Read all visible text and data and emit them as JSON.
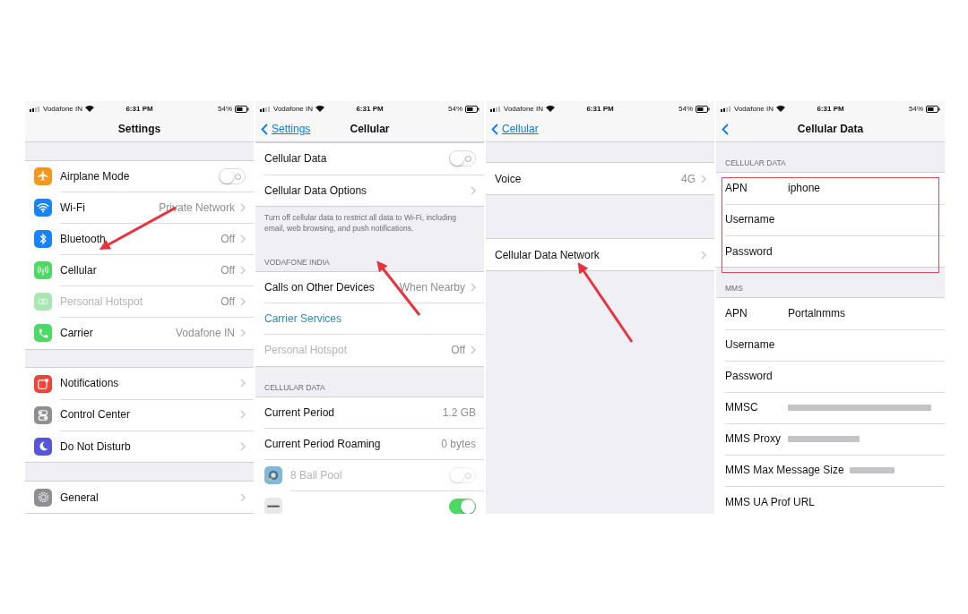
{
  "panels": [
    {
      "status_bar": {
        "carrier": "Vodafone IN",
        "time": "6:31 PM",
        "battery": "54%"
      },
      "nav": {
        "title": "Settings"
      },
      "sections": [
        {
          "highlighted": false,
          "rows": [
            {
              "kind": "toggle",
              "color": "#f6961e",
              "label": "Airplane Mode",
              "on": false,
              "disabled": false
            },
            {
              "kind": "nav",
              "color": "#1a82fb",
              "label": "Wi-Fi",
              "value": "Private Network",
              "disabled": false
            },
            {
              "kind": "nav",
              "color": "#1a82fb",
              "label": "Bluetooth",
              "value": "Off",
              "disabled": false
            },
            {
              "kind": "nav",
              "color": "#4cd964",
              "label": "Cellular",
              "value": "Off",
              "disabled": false
            },
            {
              "kind": "nav",
              "color": "#a8e6b4",
              "label": "Personal Hotspot",
              "value": "Off",
              "disabled": true
            },
            {
              "kind": "nav",
              "color": "#4cd964",
              "label": "Carrier",
              "value": "Vodafone IN",
              "disabled": false
            }
          ]
        },
        {
          "highlighted": false,
          "rows": [
            {
              "kind": "nav",
              "color": "#f0453a",
              "label": "Notifications",
              "disabled": false
            },
            {
              "kind": "nav",
              "color": "#8e8e93",
              "label": "Control Center",
              "disabled": false
            },
            {
              "kind": "nav",
              "color": "#5856d6",
              "label": "Do Not Disturb",
              "disabled": false
            }
          ]
        },
        {
          "highlighted": false,
          "rows": [
            {
              "kind": "nav",
              "color": "#8e8e93",
              "label": "General",
              "disabled": false
            }
          ]
        }
      ]
    },
    {
      "status_bar": {
        "carrier": "Vodafone IN",
        "time": "6:31 PM",
        "battery": "54%"
      },
      "nav": {
        "back": "Settings",
        "title": "Cellular"
      },
      "sections": [
        {
          "highlighted": false,
          "footer": "Turn off cellular data to restrict all data to Wi-Fi, including email, web browsing, and push notifications.",
          "rows": [
            {
              "kind": "toggle",
              "label": "Cellular Data",
              "on": false,
              "disabled": false
            },
            {
              "kind": "nav",
              "label": "Cellular Data Options",
              "disabled": false
            }
          ]
        },
        {
          "highlighted": false,
          "header": "VODAFONE INDIA",
          "rows": [
            {
              "kind": "nav",
              "label": "Calls on Other Devices",
              "value": "When Nearby",
              "disabled": false
            },
            {
              "kind": "link",
              "label": "Carrier Services",
              "disabled": false
            },
            {
              "kind": "nav",
              "label": "Personal Hotspot",
              "value": "Off",
              "disabled": true
            }
          ]
        },
        {
          "highlighted": false,
          "header": "CELLULAR DATA",
          "rows": [
            {
              "kind": "info",
              "label": "Current Period",
              "value": "1.2 GB",
              "disabled": false
            },
            {
              "kind": "info",
              "label": "Current Period Roaming",
              "value": "0 bytes",
              "disabled": false
            },
            {
              "kind": "toggle",
              "color": "#7fb8d8",
              "label": "8 Ball Pool",
              "on": false,
              "disabled": true
            },
            {
              "kind": "toggle",
              "color": "#e8e8e8",
              "on": true,
              "disabled": false
            }
          ]
        }
      ]
    },
    {
      "status_bar": {
        "carrier": "Vodafone IN",
        "time": "6:31 PM",
        "battery": "54%"
      },
      "nav": {
        "back": "Cellular"
      },
      "sections": [
        {
          "highlighted": false,
          "rows": [
            {
              "kind": "nav",
              "label": "Voice",
              "value": "4G",
              "disabled": false
            }
          ]
        },
        {
          "highlighted": false,
          "rows": [
            {
              "kind": "nav",
              "label": "Cellular Data Network",
              "disabled": false
            }
          ]
        }
      ]
    },
    {
      "status_bar": {
        "carrier": "Vodafone IN",
        "time": "6:31 PM",
        "battery": "54%"
      },
      "nav": {
        "back_button": true,
        "title": "Cellular Data"
      },
      "sections": [
        {
          "highlighted": true,
          "header": "CELLULAR DATA",
          "rows": [
            {
              "kind": "field",
              "label": "APN",
              "value": "iphone",
              "redacted": false
            },
            {
              "kind": "field",
              "label": "Username",
              "redacted": false
            },
            {
              "kind": "field",
              "label": "Password",
              "redacted": false
            }
          ]
        },
        {
          "highlighted": false,
          "header": "MMS",
          "rows": [
            {
              "kind": "field",
              "label": "APN",
              "value": "Portalnmms",
              "redacted": false
            },
            {
              "kind": "field",
              "label": "Username",
              "redacted": false
            },
            {
              "kind": "field",
              "label": "Password",
              "redacted": false
            },
            {
              "kind": "field",
              "label": "MMSC",
              "redacted": true
            },
            {
              "kind": "field",
              "label": "MMS Proxy",
              "redacted": true
            },
            {
              "kind": "field",
              "label": "MMS Max Message Size",
              "redacted": true
            },
            {
              "kind": "field",
              "label": "MMS UA Prof URL",
              "redacted": false
            }
          ]
        }
      ]
    }
  ]
}
